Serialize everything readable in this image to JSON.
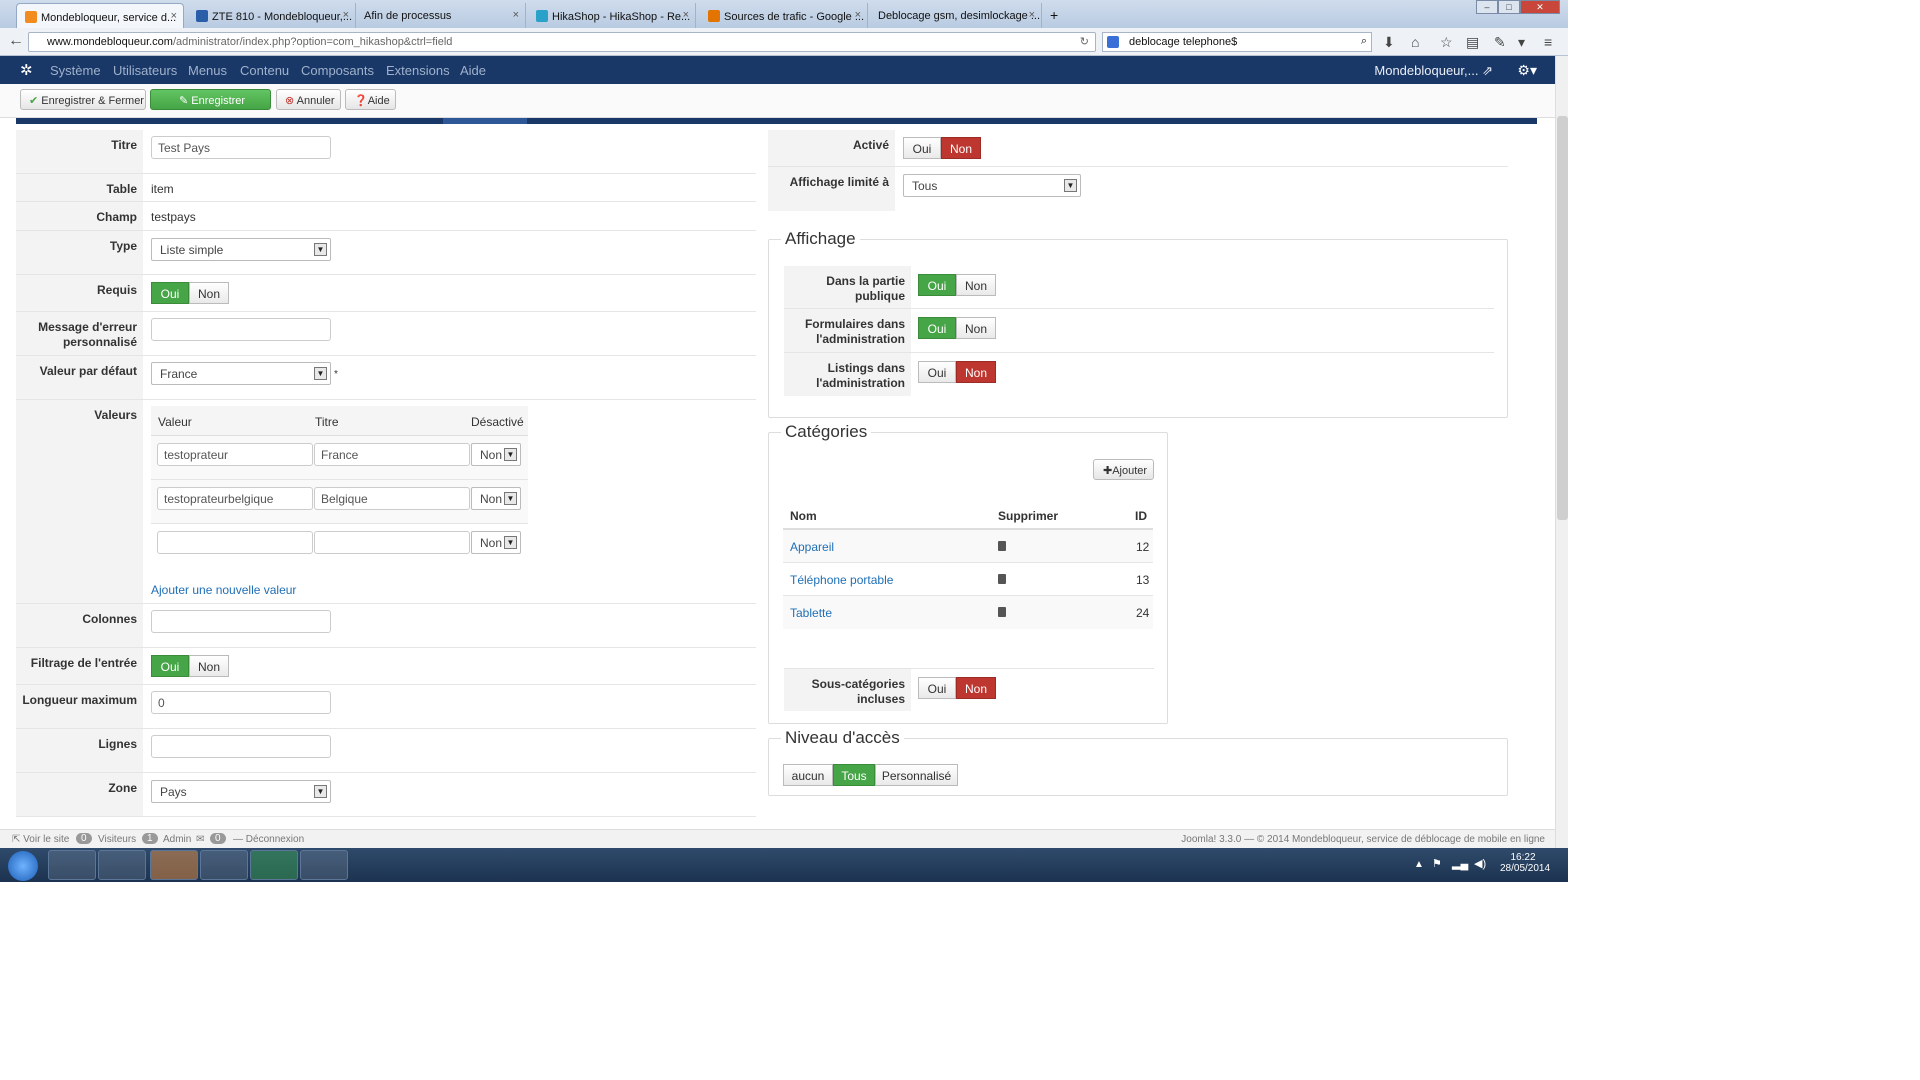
{
  "browser": {
    "tabs": [
      {
        "label": "Mondebloqueur, service d...",
        "active": true
      },
      {
        "label": "ZTE 810 - Mondebloqueur,..."
      },
      {
        "label": "Afin de processus"
      },
      {
        "label": "HikaShop - HikaShop - Re..."
      },
      {
        "label": "Sources de trafic - Google ..."
      },
      {
        "label": "Deblocage gsm, desimlockage ..."
      }
    ],
    "url_host": "www.mondebloqueur.com",
    "url_path": "/administrator/index.php?option=com_hikashop&ctrl=field",
    "search_value": "deblocage telephone$"
  },
  "admin_nav": {
    "items": [
      "Système",
      "Utilisateurs",
      "Menus",
      "Contenu",
      "Composants",
      "Extensions",
      "Aide"
    ],
    "user": "Mondebloqueur,..."
  },
  "toolbar": {
    "save_close": "Enregistrer & Fermer",
    "save": "Enregistrer",
    "cancel": "Annuler",
    "help": "Aide"
  },
  "form": {
    "titre": {
      "label": "Titre",
      "value": "Test Pays"
    },
    "table": {
      "label": "Table",
      "value": "item"
    },
    "champ": {
      "label": "Champ",
      "value": "testpays"
    },
    "type": {
      "label": "Type",
      "value": "Liste simple"
    },
    "requis": {
      "label": "Requis",
      "oui": "Oui",
      "non": "Non"
    },
    "message": {
      "label": "Message d'erreur personnalisé",
      "value": ""
    },
    "defaut": {
      "label": "Valeur par défaut",
      "value": "France",
      "marker": "*"
    },
    "valeurs": {
      "label": "Valeurs",
      "headers": [
        "Valeur",
        "Titre",
        "Désactivé"
      ],
      "rows": [
        {
          "valeur": "testoprateur",
          "titre": "France",
          "desactive": "Non"
        },
        {
          "valeur": "testoprateurbelgique",
          "titre": "Belgique",
          "desactive": "Non"
        },
        {
          "valeur": "",
          "titre": "",
          "desactive": "Non"
        }
      ],
      "add_link": "Ajouter une nouvelle valeur"
    },
    "colonnes": {
      "label": "Colonnes",
      "value": ""
    },
    "filtrage": {
      "label": "Filtrage de l'entrée",
      "oui": "Oui",
      "non": "Non"
    },
    "longueur": {
      "label": "Longueur maximum",
      "value": "0"
    },
    "lignes": {
      "label": "Lignes",
      "value": ""
    },
    "zone": {
      "label": "Zone",
      "value": "Pays"
    }
  },
  "right": {
    "active": {
      "label": "Activé",
      "oui": "Oui",
      "non": "Non"
    },
    "affichage_limite": {
      "label": "Affichage limité à",
      "value": "Tous"
    },
    "affichage": {
      "legend": "Affichage",
      "rows": [
        {
          "label": "Dans la partie publique",
          "oui": "Oui",
          "non": "Non"
        },
        {
          "label": "Formulaires dans l'administration",
          "oui": "Oui",
          "non": "Non"
        },
        {
          "label": "Listings dans l'administration",
          "oui": "Oui",
          "non": "Non"
        }
      ]
    },
    "categories": {
      "legend": "Catégories",
      "add": "Ajouter",
      "headers": [
        "Nom",
        "Supprimer",
        "ID"
      ],
      "rows": [
        {
          "nom": "Appareil",
          "id": "12"
        },
        {
          "nom": "Téléphone portable",
          "id": "13"
        },
        {
          "nom": "Tablette",
          "id": "24"
        }
      ],
      "sub_label": "Sous-catégories incluses",
      "oui": "Oui",
      "non": "Non"
    },
    "acces": {
      "legend": "Niveau d'accès",
      "options": [
        "aucun",
        "Tous",
        "Personnalisé"
      ]
    }
  },
  "status": {
    "view_site": "Voir le site",
    "visitors_count": "0",
    "visitors": "Visiteurs",
    "admin_count": "1",
    "admin": "Admin",
    "msg_count": "0",
    "logout": "Déconnexion",
    "footer": "Joomla! 3.3.0 — © 2014 Mondebloqueur, service de déblocage de mobile en ligne"
  },
  "taskbar": {
    "time": "16:22",
    "date": "28/05/2014"
  },
  "colors": {
    "green": "#46a546",
    "red": "#bd362f",
    "navy": "#1a3867",
    "link": "#1f6fb5"
  }
}
